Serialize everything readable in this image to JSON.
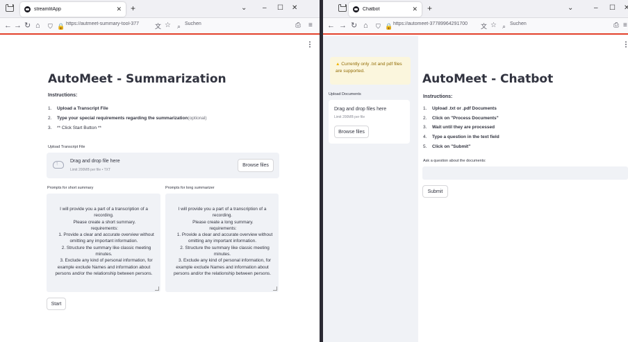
{
  "left_window": {
    "tab_title": "streamlitApp",
    "url": "https://autmeet-summary-tool-377",
    "search_label": "Suchen",
    "page_title": "AutoMeet - Summarization",
    "instructions_heading": "Instructions:",
    "steps": [
      {
        "num": "1.",
        "bold": "Upload a Transcript File",
        "rest": ""
      },
      {
        "num": "2.",
        "bold": "Type your special requirements regarding the summarization",
        "rest": " (optional)"
      },
      {
        "num": "3.",
        "bold": "",
        "rest": "** Click Start Button **"
      }
    ],
    "upload_label": "Upload Transcript File",
    "dropzone_main": "Drag and drop file here",
    "dropzone_sub": "Limit 200MB per file • TXT",
    "browse_label": "Browse files",
    "short_label": "Prompts for short summary",
    "long_label": "Prompts for long summarizer",
    "short_prompt": "I will provide you a part of a transcription of a recording.\n Please create a short summary.\n requirements:\n    1. Provide a clear and accurate overview without omitting any important information.\n    2. Structure the summary like classic meeting minutes.\n    3. Exclude any kind of personal information, for example exclude Names and information about persons and/or the relationship between persons.",
    "long_prompt": "I will provide you a part of a transcription of a recording.\n Please create a long summary.\n requirements:\n    1. Provide a clear and accurate overview without omitting any important information.\n    2. Structure the summary like classic meeting minutes.\n    3. Exclude any kind of personal information, for example exclude Names and information about persons and/or the relationship between persons.",
    "start_label": "Start"
  },
  "right_window": {
    "tab_title": "Chatbot",
    "url": "https://automeet-37789964291700",
    "search_label": "Suchen",
    "warning_text": "Currently only .txt and pdf files are supported.",
    "upload_label": "Upload Documents",
    "dropzone_main": "Drag and drop files here",
    "dropzone_sub": "Limit 200MB per file",
    "browse_label": "Browse files",
    "page_title": "AutoMeet - Chatbot",
    "instructions_heading": "Instructions:",
    "steps": [
      {
        "num": "1.",
        "bold": "Upload .txt or .pdf Documents"
      },
      {
        "num": "2.",
        "bold": "Click on \"Process Documents\""
      },
      {
        "num": "3.",
        "bold": "Wait until they are processed"
      },
      {
        "num": "4.",
        "bold": "Type a question in the text field"
      },
      {
        "num": "5.",
        "bold": "Click on \"Submit\""
      }
    ],
    "question_label": "Ask a question about the documents:",
    "submit_label": "Submit"
  },
  "colors": {
    "accent_bar": "#e3402a",
    "text": "#31333f",
    "warning_bg": "#fbf6dd",
    "warning_text": "#926c05"
  }
}
